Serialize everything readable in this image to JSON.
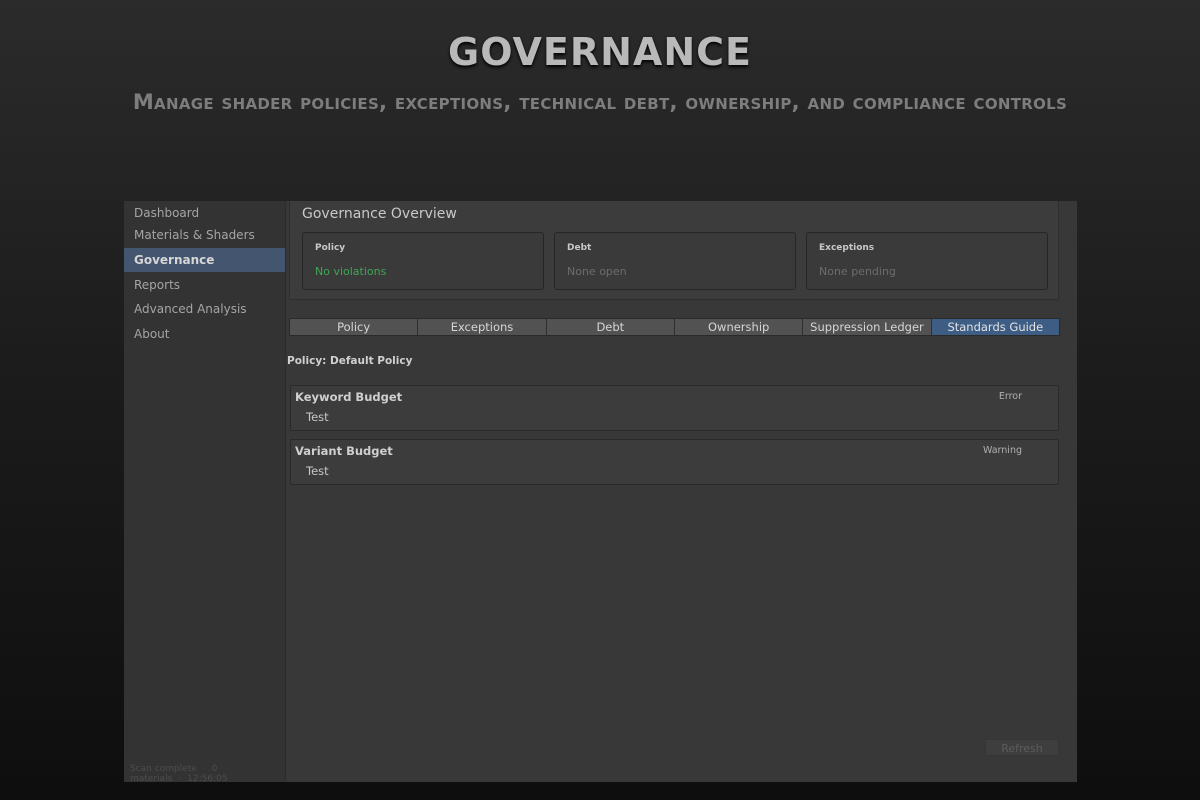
{
  "hero": {
    "title": "GOVERNANCE",
    "subtitle": "Manage shader policies, exceptions, technical debt, ownership, and compliance controls"
  },
  "sidebar": {
    "items": [
      {
        "label": "Dashboard",
        "active": false
      },
      {
        "label": "Materials & Shaders",
        "active": false
      },
      {
        "label": "Governance",
        "active": true
      },
      {
        "label": "Reports",
        "active": false
      },
      {
        "label": "Advanced Analysis",
        "active": false
      },
      {
        "label": "About",
        "active": false
      }
    ],
    "status": {
      "scan": "Scan complete",
      "separator": "·",
      "materials": "0 materials",
      "time": "12:56:05"
    }
  },
  "overview": {
    "title": "Governance Overview",
    "cards": [
      {
        "label": "Policy",
        "value": "No violations",
        "status": "ok"
      },
      {
        "label": "Debt",
        "value": "None open",
        "status": "muted"
      },
      {
        "label": "Exceptions",
        "value": "None pending",
        "status": "muted"
      }
    ]
  },
  "tabs": [
    {
      "label": "Policy",
      "active": false
    },
    {
      "label": "Exceptions",
      "active": false
    },
    {
      "label": "Debt",
      "active": false
    },
    {
      "label": "Ownership",
      "active": false
    },
    {
      "label": "Suppression Ledger",
      "active": false
    },
    {
      "label": "Standards Guide",
      "active": true
    }
  ],
  "policy": {
    "header": "Policy: Default Policy",
    "rules": [
      {
        "name": "Keyword Budget",
        "description": "Test",
        "severity": "Error"
      },
      {
        "name": "Variant Budget",
        "description": "Test",
        "severity": "Warning"
      }
    ]
  },
  "actions": {
    "refresh_label": "Refresh"
  },
  "colors": {
    "accent": "#44556f",
    "active_tab": "#3d5d85",
    "ok": "#3fa657"
  }
}
